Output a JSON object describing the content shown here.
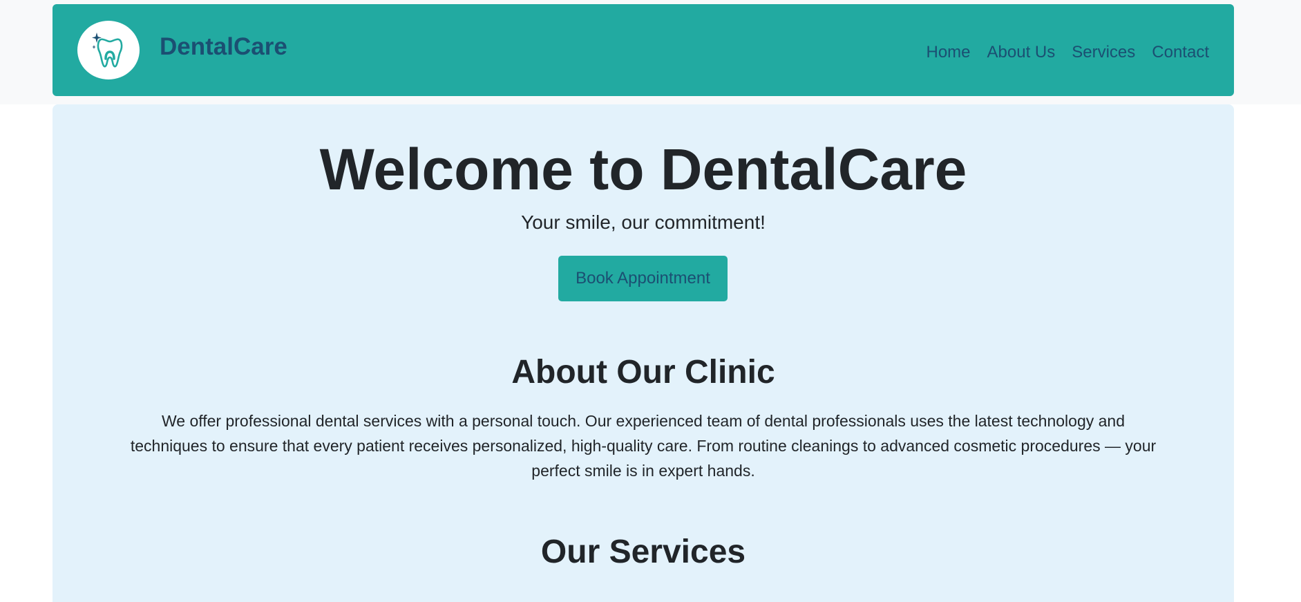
{
  "navbar": {
    "brand": "DentalCare",
    "logo_icon": "tooth-sparkle-icon",
    "links": [
      {
        "label": "Home"
      },
      {
        "label": "About Us"
      },
      {
        "label": "Services"
      },
      {
        "label": "Contact"
      }
    ]
  },
  "hero": {
    "title": "Welcome to DentalCare",
    "subtitle": "Your smile, our commitment!",
    "cta_label": "Book Appointment"
  },
  "about": {
    "heading": "About Our Clinic",
    "text": "We offer professional dental services with a personal touch. Our experienced team of dental professionals uses the latest technology and techniques to ensure that every patient receives personalized, high-quality care. From routine cleanings to advanced cosmetic procedures — your perfect smile is in expert hands."
  },
  "services": {
    "heading": "Our Services"
  },
  "colors": {
    "primary": "#22aaa1",
    "navy": "#1b4f72",
    "card_bg": "#e3f2fb",
    "text": "#212529"
  }
}
